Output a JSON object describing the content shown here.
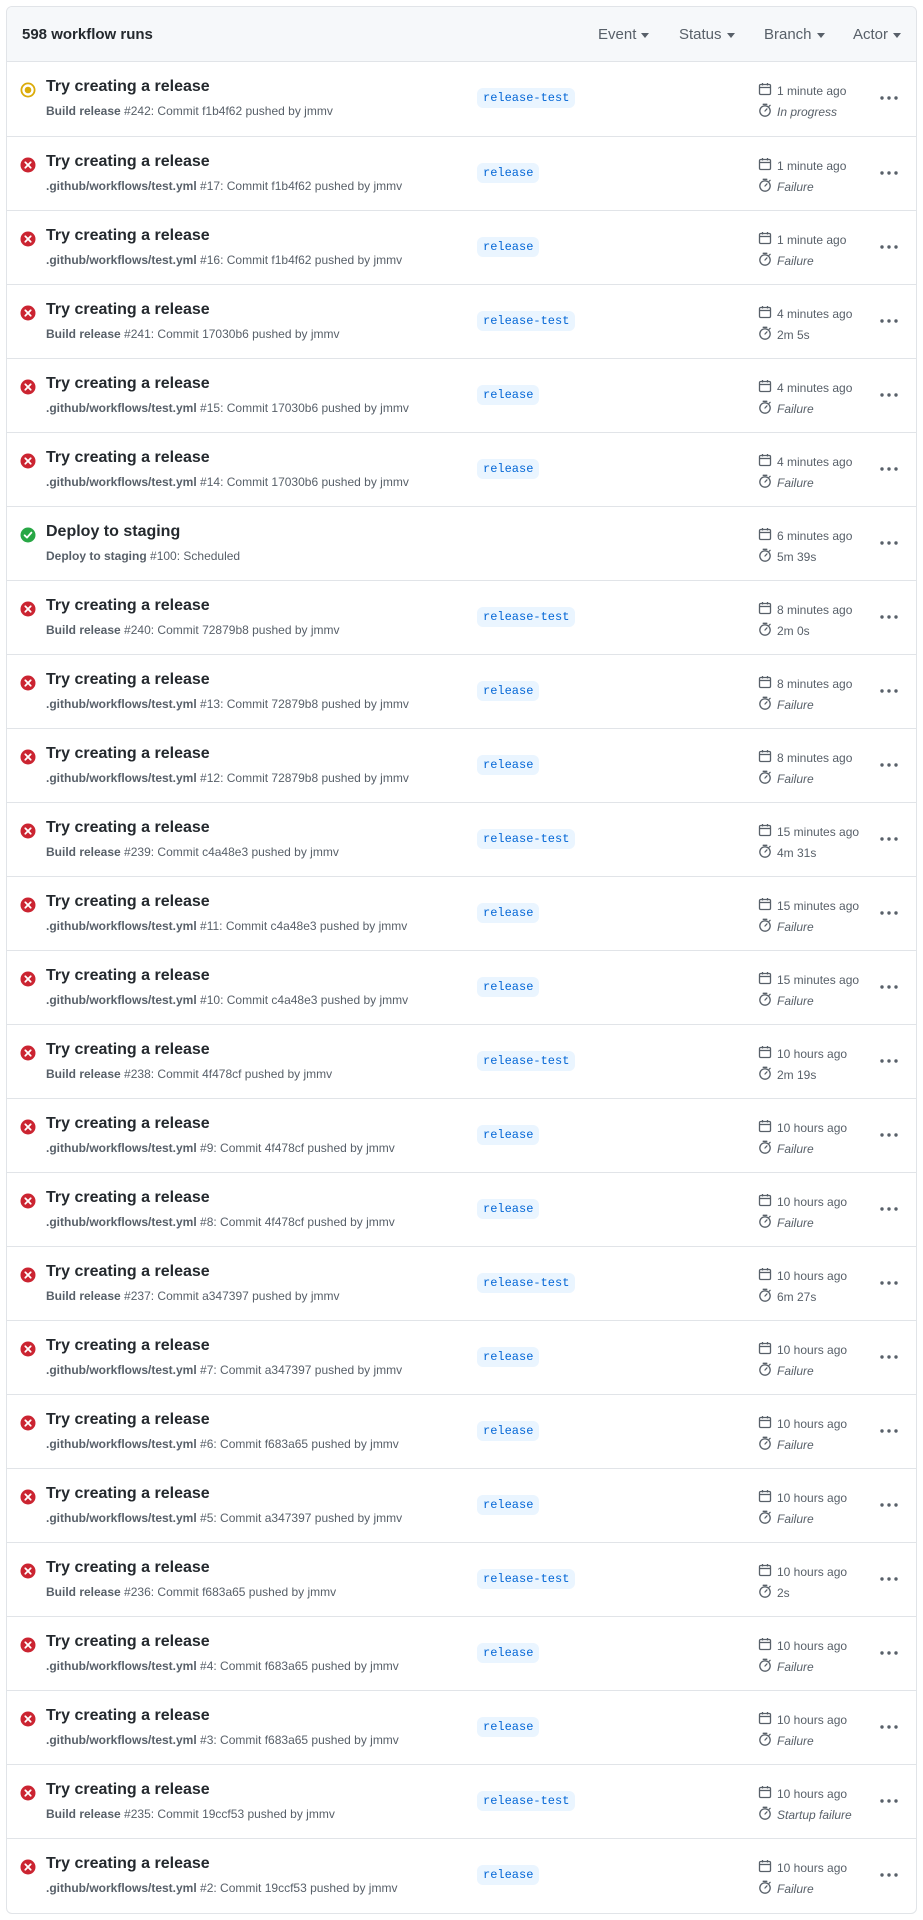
{
  "header": {
    "runs_count": "598 workflow runs",
    "filters": {
      "event": "Event",
      "status": "Status",
      "branch": "Branch",
      "actor": "Actor"
    }
  },
  "colors": {
    "failure": "#cb2431",
    "success": "#28a745",
    "in_progress": "#dbab09",
    "branch_bg": "#eaf5ff",
    "branch_fg": "#0366d6"
  },
  "runs": [
    {
      "status": "in_progress",
      "title": "Try creating a release",
      "workflow": "Build release",
      "number": "#242",
      "detail": ": Commit f1b4f62 pushed by jmmv",
      "branch": "release-test",
      "time": "1 minute ago",
      "duration": "In progress",
      "italic": true
    },
    {
      "status": "failure",
      "title": "Try creating a release",
      "workflow": ".github/workflows/test.yml",
      "number": "#17",
      "detail": ": Commit f1b4f62 pushed by jmmv",
      "branch": "release",
      "time": "1 minute ago",
      "duration": "Failure",
      "italic": true
    },
    {
      "status": "failure",
      "title": "Try creating a release",
      "workflow": ".github/workflows/test.yml",
      "number": "#16",
      "detail": ": Commit f1b4f62 pushed by jmmv",
      "branch": "release",
      "time": "1 minute ago",
      "duration": "Failure",
      "italic": true
    },
    {
      "status": "failure",
      "title": "Try creating a release",
      "workflow": "Build release",
      "number": "#241",
      "detail": ": Commit 17030b6 pushed by jmmv",
      "branch": "release-test",
      "time": "4 minutes ago",
      "duration": "2m 5s",
      "italic": false
    },
    {
      "status": "failure",
      "title": "Try creating a release",
      "workflow": ".github/workflows/test.yml",
      "number": "#15",
      "detail": ": Commit 17030b6 pushed by jmmv",
      "branch": "release",
      "time": "4 minutes ago",
      "duration": "Failure",
      "italic": true
    },
    {
      "status": "failure",
      "title": "Try creating a release",
      "workflow": ".github/workflows/test.yml",
      "number": "#14",
      "detail": ": Commit 17030b6 pushed by jmmv",
      "branch": "release",
      "time": "4 minutes ago",
      "duration": "Failure",
      "italic": true
    },
    {
      "status": "success",
      "title": "Deploy to staging",
      "workflow": "Deploy to staging",
      "number": "#100",
      "detail": ": Scheduled",
      "branch": "",
      "time": "6 minutes ago",
      "duration": "5m 39s",
      "italic": false
    },
    {
      "status": "failure",
      "title": "Try creating a release",
      "workflow": "Build release",
      "number": "#240",
      "detail": ": Commit 72879b8 pushed by jmmv",
      "branch": "release-test",
      "time": "8 minutes ago",
      "duration": "2m 0s",
      "italic": false
    },
    {
      "status": "failure",
      "title": "Try creating a release",
      "workflow": ".github/workflows/test.yml",
      "number": "#13",
      "detail": ": Commit 72879b8 pushed by jmmv",
      "branch": "release",
      "time": "8 minutes ago",
      "duration": "Failure",
      "italic": true
    },
    {
      "status": "failure",
      "title": "Try creating a release",
      "workflow": ".github/workflows/test.yml",
      "number": "#12",
      "detail": ": Commit 72879b8 pushed by jmmv",
      "branch": "release",
      "time": "8 minutes ago",
      "duration": "Failure",
      "italic": true
    },
    {
      "status": "failure",
      "title": "Try creating a release",
      "workflow": "Build release",
      "number": "#239",
      "detail": ": Commit c4a48e3 pushed by jmmv",
      "branch": "release-test",
      "time": "15 minutes ago",
      "duration": "4m 31s",
      "italic": false
    },
    {
      "status": "failure",
      "title": "Try creating a release",
      "workflow": ".github/workflows/test.yml",
      "number": "#11",
      "detail": ": Commit c4a48e3 pushed by jmmv",
      "branch": "release",
      "time": "15 minutes ago",
      "duration": "Failure",
      "italic": true
    },
    {
      "status": "failure",
      "title": "Try creating a release",
      "workflow": ".github/workflows/test.yml",
      "number": "#10",
      "detail": ": Commit c4a48e3 pushed by jmmv",
      "branch": "release",
      "time": "15 minutes ago",
      "duration": "Failure",
      "italic": true
    },
    {
      "status": "failure",
      "title": "Try creating a release",
      "workflow": "Build release",
      "number": "#238",
      "detail": ": Commit 4f478cf pushed by jmmv",
      "branch": "release-test",
      "time": "10 hours ago",
      "duration": "2m 19s",
      "italic": false
    },
    {
      "status": "failure",
      "title": "Try creating a release",
      "workflow": ".github/workflows/test.yml",
      "number": "#9",
      "detail": ": Commit 4f478cf pushed by jmmv",
      "branch": "release",
      "time": "10 hours ago",
      "duration": "Failure",
      "italic": true
    },
    {
      "status": "failure",
      "title": "Try creating a release",
      "workflow": ".github/workflows/test.yml",
      "number": "#8",
      "detail": ": Commit 4f478cf pushed by jmmv",
      "branch": "release",
      "time": "10 hours ago",
      "duration": "Failure",
      "italic": true
    },
    {
      "status": "failure",
      "title": "Try creating a release",
      "workflow": "Build release",
      "number": "#237",
      "detail": ": Commit a347397 pushed by jmmv",
      "branch": "release-test",
      "time": "10 hours ago",
      "duration": "6m 27s",
      "italic": false
    },
    {
      "status": "failure",
      "title": "Try creating a release",
      "workflow": ".github/workflows/test.yml",
      "number": "#7",
      "detail": ": Commit a347397 pushed by jmmv",
      "branch": "release",
      "time": "10 hours ago",
      "duration": "Failure",
      "italic": true
    },
    {
      "status": "failure",
      "title": "Try creating a release",
      "workflow": ".github/workflows/test.yml",
      "number": "#6",
      "detail": ": Commit f683a65 pushed by jmmv",
      "branch": "release",
      "time": "10 hours ago",
      "duration": "Failure",
      "italic": true
    },
    {
      "status": "failure",
      "title": "Try creating a release",
      "workflow": ".github/workflows/test.yml",
      "number": "#5",
      "detail": ": Commit a347397 pushed by jmmv",
      "branch": "release",
      "time": "10 hours ago",
      "duration": "Failure",
      "italic": true
    },
    {
      "status": "failure",
      "title": "Try creating a release",
      "workflow": "Build release",
      "number": "#236",
      "detail": ": Commit f683a65 pushed by jmmv",
      "branch": "release-test",
      "time": "10 hours ago",
      "duration": "2s",
      "italic": false
    },
    {
      "status": "failure",
      "title": "Try creating a release",
      "workflow": ".github/workflows/test.yml",
      "number": "#4",
      "detail": ": Commit f683a65 pushed by jmmv",
      "branch": "release",
      "time": "10 hours ago",
      "duration": "Failure",
      "italic": true
    },
    {
      "status": "failure",
      "title": "Try creating a release",
      "workflow": ".github/workflows/test.yml",
      "number": "#3",
      "detail": ": Commit f683a65 pushed by jmmv",
      "branch": "release",
      "time": "10 hours ago",
      "duration": "Failure",
      "italic": true
    },
    {
      "status": "failure",
      "title": "Try creating a release",
      "workflow": "Build release",
      "number": "#235",
      "detail": ": Commit 19ccf53 pushed by jmmv",
      "branch": "release-test",
      "time": "10 hours ago",
      "duration": "Startup failure",
      "italic": true
    },
    {
      "status": "failure",
      "title": "Try creating a release",
      "workflow": ".github/workflows/test.yml",
      "number": "#2",
      "detail": ": Commit 19ccf53 pushed by jmmv",
      "branch": "release",
      "time": "10 hours ago",
      "duration": "Failure",
      "italic": true
    }
  ]
}
